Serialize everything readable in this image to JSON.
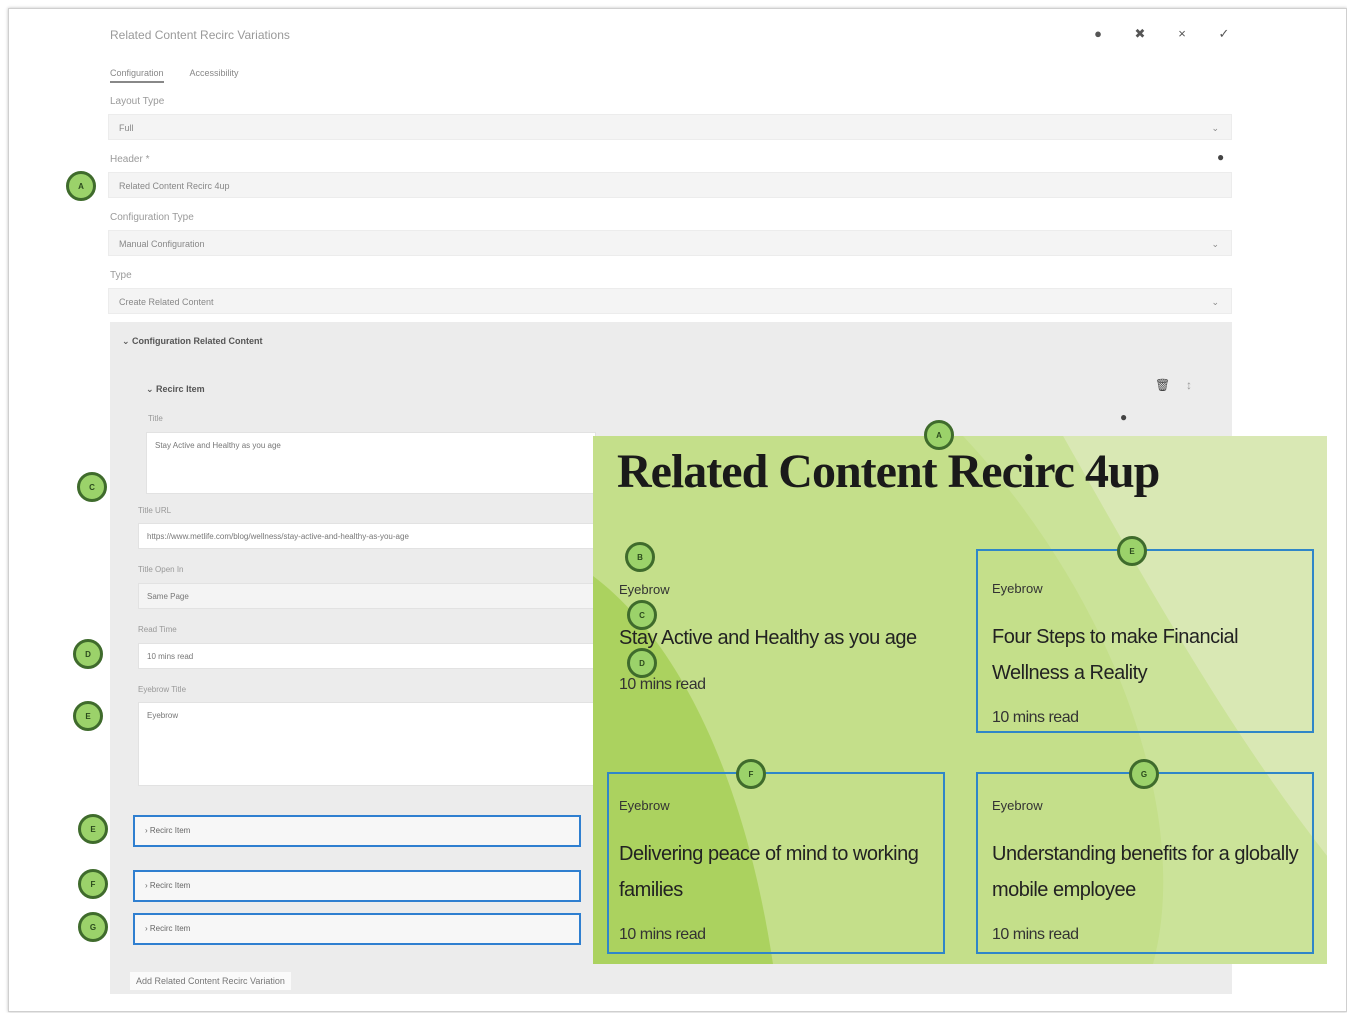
{
  "dialog": {
    "title": "Related Content Recirc Variations",
    "tabs": [
      "Configuration",
      "Accessibility"
    ],
    "layout_type": {
      "label": "Layout Type",
      "value": "Full"
    },
    "header": {
      "label": "Header *",
      "value": "Related Content Recirc 4up"
    },
    "configuration_type": {
      "label": "Configuration Type",
      "value": "Manual Configuration"
    },
    "type": {
      "label": "Type",
      "value": "Create Related Content"
    },
    "section_title": "Configuration Related Content",
    "recirc_item": {
      "heading": "Recirc Item",
      "title_label": "Title",
      "title_value": "Stay Active and Healthy as you age",
      "url_label": "Title URL",
      "url_value": "https://www.metlife.com/blog/wellness/stay-active-and-healthy-as-you-age",
      "open_in_label": "Title Open In",
      "open_in_value": "Same Page",
      "read_time_label": "Read Time",
      "read_time_value": "10 mins read",
      "eyebrow_label": "Eyebrow Title",
      "eyebrow_value": "Eyebrow"
    },
    "collapsed_items": [
      "Recirc Item",
      "Recirc Item",
      "Recirc Item"
    ],
    "add_button": "Add Related Content Recirc Variation"
  },
  "markers": [
    "A",
    "C",
    "D",
    "E",
    "E",
    "F",
    "G",
    "A",
    "B",
    "C",
    "D",
    "E",
    "F",
    "G"
  ],
  "preview": {
    "title": "Related Content Recirc 4up",
    "cards": [
      {
        "eyebrow": "Eyebrow",
        "headline": "Stay Active and Healthy as you age",
        "read": "10 mins read"
      },
      {
        "eyebrow": "Eyebrow",
        "headline": "Four Steps to make Financial Wellness a Reality",
        "read": "10 mins read"
      },
      {
        "eyebrow": "Eyebrow",
        "headline": "Delivering peace of mind to working families",
        "read": "10 mins read"
      },
      {
        "eyebrow": "Eyebrow",
        "headline": "Understanding benefits for a globally mobile employee",
        "read": "10 mins read"
      }
    ]
  },
  "colors": {
    "highlight_blue": "#2f86c8",
    "preview_green": "#c4df8a",
    "marker_green": "#9bd26a"
  }
}
